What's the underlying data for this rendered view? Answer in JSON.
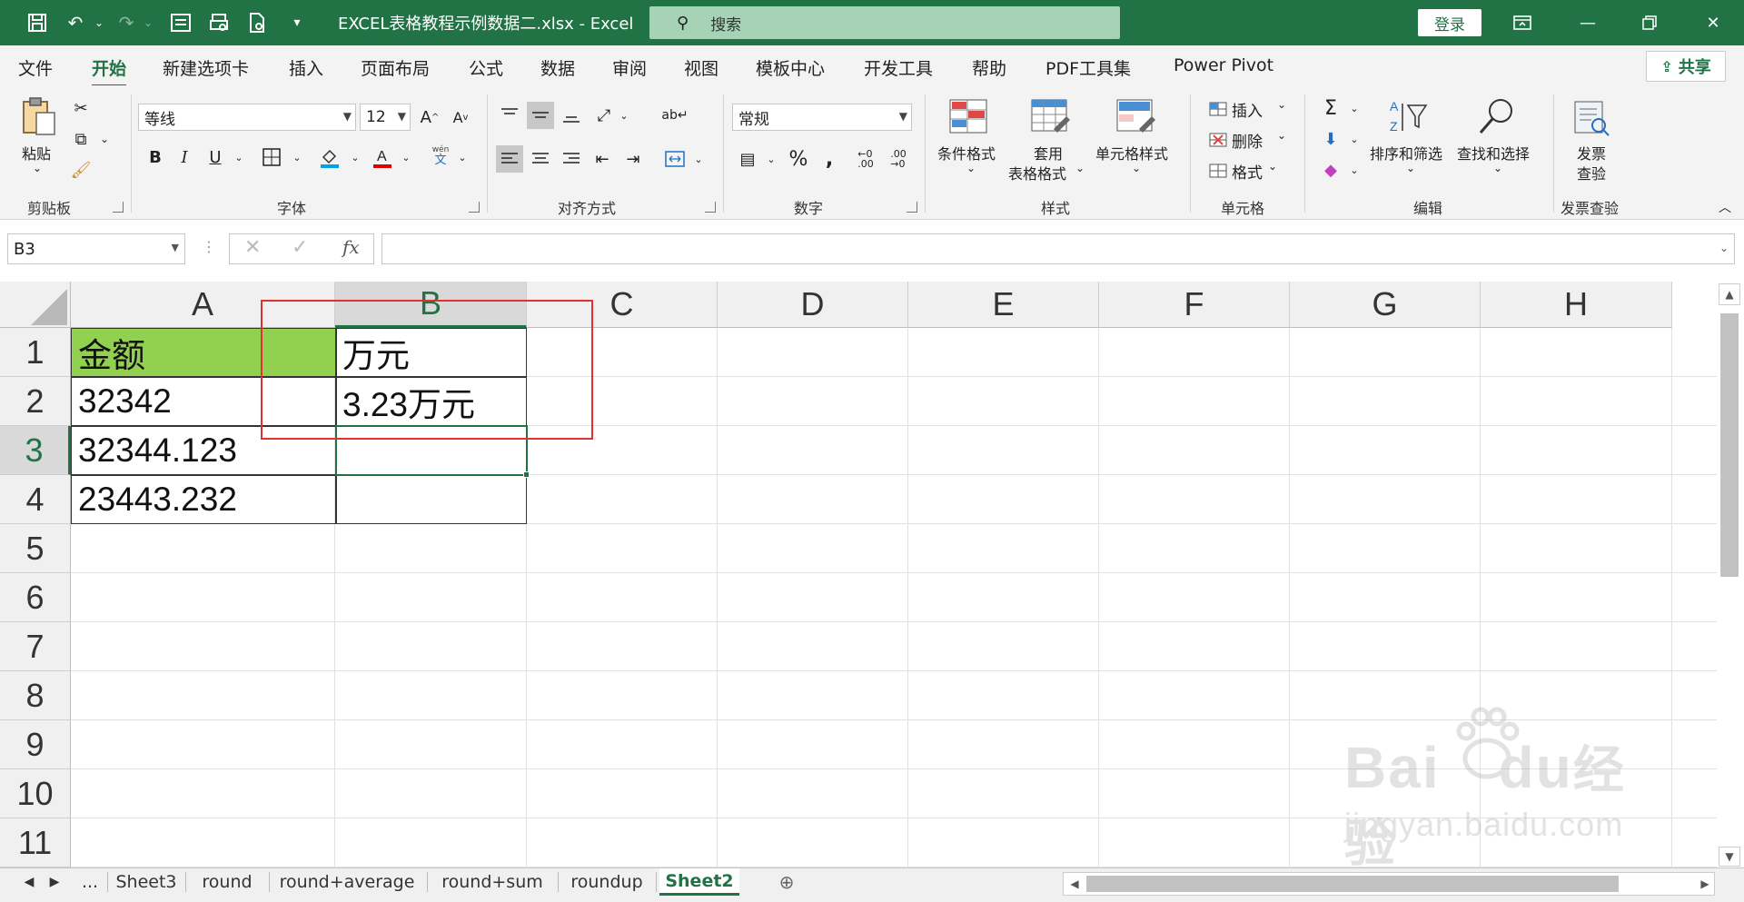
{
  "window": {
    "title": "EXCEL表格教程示例数据二.xlsx  -  Excel",
    "search_placeholder": "搜索",
    "login_label": "登录"
  },
  "menu": {
    "tabs": [
      "文件",
      "开始",
      "新建选项卡",
      "插入",
      "页面布局",
      "公式",
      "数据",
      "审阅",
      "视图",
      "模板中心",
      "开发工具",
      "帮助",
      "PDF工具集",
      "Power Pivot"
    ],
    "active_tab": "开始",
    "share_label": "共享"
  },
  "ribbon": {
    "clipboard": {
      "paste_label": "粘贴",
      "group_label": "剪贴板"
    },
    "font": {
      "font_name": "等线",
      "font_size": "12",
      "group_label": "字体",
      "bold": "B",
      "italic": "I",
      "underline": "U",
      "wen": "wén",
      "wen_char": "文"
    },
    "alignment": {
      "group_label": "对齐方式"
    },
    "number": {
      "format": "常规",
      "group_label": "数字"
    },
    "styles": {
      "conditional": "条件格式",
      "table_format_1": "套用",
      "table_format_2": "表格格式",
      "cell_styles": "单元格样式",
      "group_label": "样式"
    },
    "cells": {
      "insert": "插入",
      "delete": "删除",
      "format": "格式",
      "group_label": "单元格"
    },
    "editing": {
      "sort_filter": "排序和筛选",
      "find_select": "查找和选择",
      "group_label": "编辑"
    },
    "invoice": {
      "check_1": "发票",
      "check_2": "查验",
      "group_label": "发票查验"
    }
  },
  "formula_bar": {
    "name_box": "B3",
    "fx_label": "fx",
    "formula": ""
  },
  "grid": {
    "columns": [
      "A",
      "B",
      "C",
      "D",
      "E",
      "F",
      "G",
      "H"
    ],
    "selected_column": "B",
    "rows": [
      "1",
      "2",
      "3",
      "4",
      "5",
      "6",
      "7",
      "8",
      "9",
      "10",
      "11"
    ],
    "selected_row": "3",
    "cells": {
      "A1": "金额",
      "B1": "万元",
      "A2": "32342",
      "B2": "3.23万元",
      "A3": "32344.123",
      "A4": "23443.232"
    },
    "header_fill_color": "#92d050",
    "highlight_box_color": "#e03030"
  },
  "sheets": {
    "tabs": [
      "Sheet3",
      "round",
      "round+average",
      "round+sum",
      "roundup",
      "Sheet2"
    ],
    "active": "Sheet2",
    "more": "..."
  },
  "watermark": {
    "brand": "Bai",
    "brand2": "du",
    "brand_cn": "经验",
    "url": "jingyan.baidu.com"
  }
}
